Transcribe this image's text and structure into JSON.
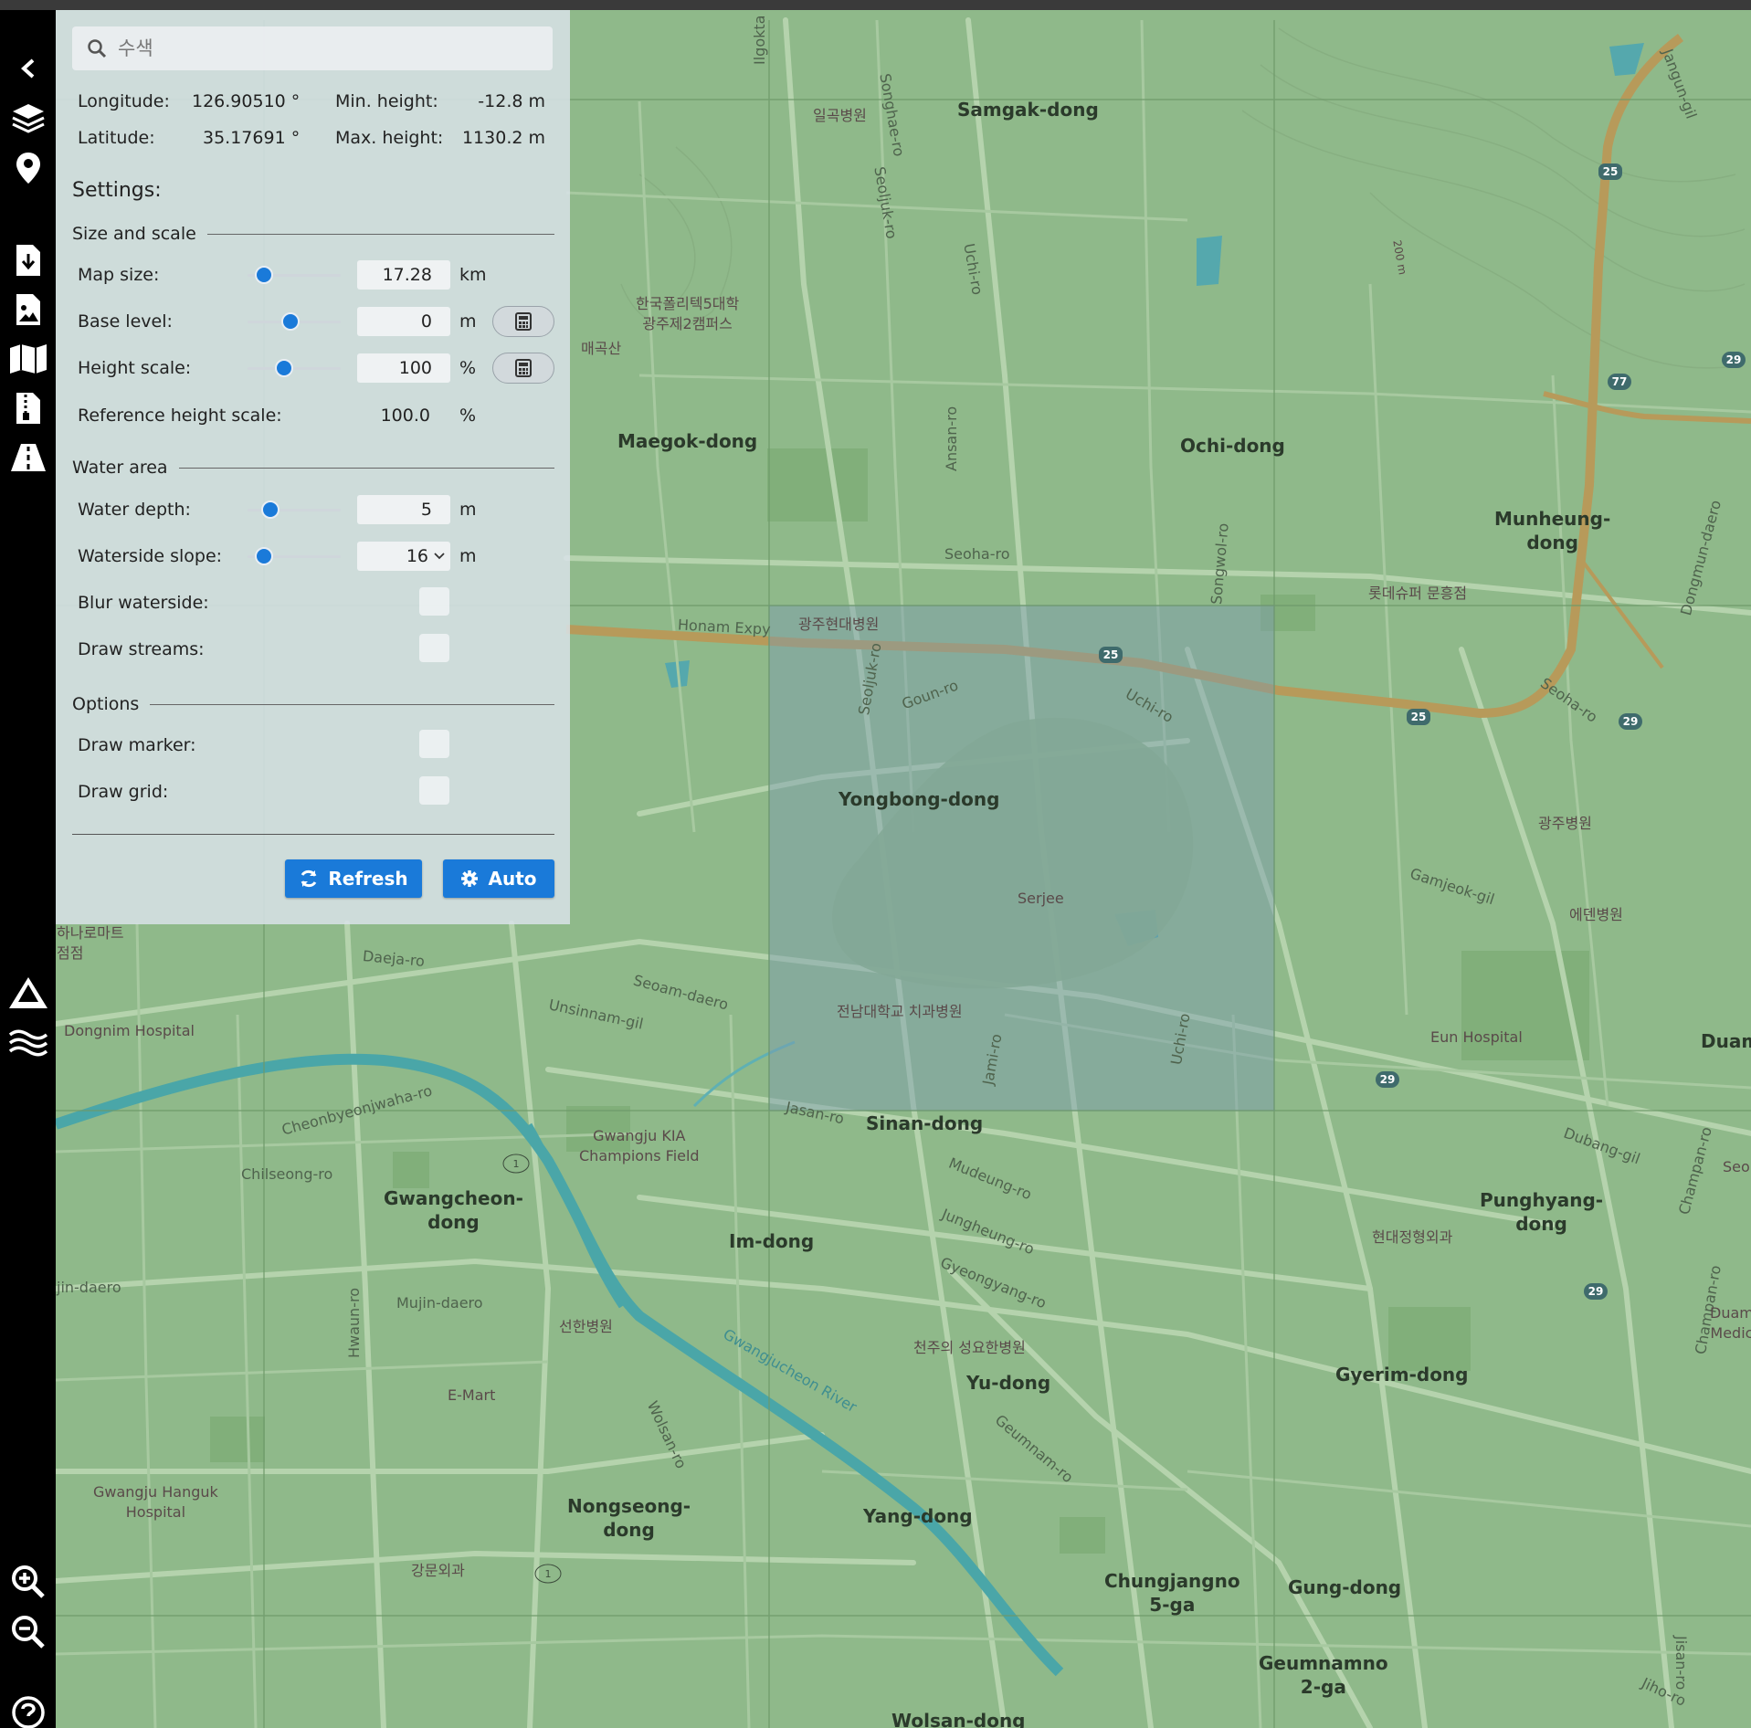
{
  "search": {
    "placeholder": "수색"
  },
  "info": {
    "longitude_label": "Longitude:",
    "longitude_value": "126.90510 °",
    "latitude_label": "Latitude:",
    "latitude_value": "35.17691 °",
    "min_height_label": "Min. height:",
    "min_height_value": "-12.8 m",
    "max_height_label": "Max. height:",
    "max_height_value": "1130.2 m"
  },
  "settings": {
    "heading": "Settings:",
    "size_scale": {
      "section": "Size and scale",
      "map_size": {
        "label": "Map size:",
        "value": "17.28",
        "unit": "km",
        "level": 0.1
      },
      "base_level": {
        "label": "Base level:",
        "value": "0",
        "unit": "m",
        "level": 0.45
      },
      "height_scale": {
        "label": "Height scale:",
        "value": "100",
        "unit": "%",
        "level": 0.37
      },
      "ref_height_scale": {
        "label": "Reference height scale:",
        "value": "100.0",
        "unit": "%"
      }
    },
    "water": {
      "section": "Water area",
      "water_depth": {
        "label": "Water depth:",
        "value": "5",
        "unit": "m",
        "level": 0.18
      },
      "waterside_slope": {
        "label": "Waterside slope:",
        "value": "16",
        "unit": "m",
        "level": 0.1
      },
      "blur_waterside": {
        "label": "Blur waterside:"
      },
      "draw_streams": {
        "label": "Draw streams:"
      }
    },
    "options": {
      "section": "Options",
      "draw_marker": {
        "label": "Draw marker:"
      },
      "draw_grid": {
        "label": "Draw grid:"
      }
    },
    "refresh_label": "Refresh",
    "auto_label": "Auto"
  },
  "map": {
    "districts": [
      "Samgak-dong",
      "Maegok-dong",
      "Ochi-dong",
      "Munheung-\ndong",
      "Yongbong-dong",
      "Sinan-dong",
      "Gwangcheon-\ndong",
      "Im-dong",
      "Punghyang-\ndong",
      "Gyerim-dong",
      "Yu-dong",
      "Nongseong-\ndong",
      "Yang-dong",
      "Chungjangno\n5-ga",
      "Gung-dong",
      "Geumnamno\n2-ga",
      "Wolsan-dong",
      "Duam"
    ],
    "streets": [
      "Ilgokta",
      "Songhae-ro",
      "Seoljuk-ro",
      "Uchi-ro",
      "Ansan-ro",
      "Seoha-ro",
      "Songwol-ro",
      "Honam Expy",
      "Goun-ro",
      "Seoljuk-ro",
      "Uchi-ro",
      "Seoha-ro",
      "Dongmun-daero",
      "Jangun-gil",
      "Gamjeok-gil",
      "Daeja-ro",
      "Seoam-daero",
      "Unsinnam-gil",
      "Cheonbyeonjwaha-ro",
      "Chilseong-ro",
      "Jasan-ro",
      "Jami-ro",
      "Uchi-ro",
      "Mudeung-ro",
      "Jungheung-ro",
      "Gyeongyang-ro",
      "Dubang-gil",
      "Champan-ro",
      "Mujin-daero",
      "Hwaun-ro",
      "Wolsan-ro",
      "Geumnam-ro",
      "jin-daero",
      "Jiho-ro",
      "Gwangjucheon River",
      "Champan-ro",
      "Jisan-ro"
    ],
    "places": [
      "일곡병원",
      "한국폴리텍5대학\n광주제2캠퍼스",
      "매곡산",
      "롯데슈퍼 문흥점",
      "광주현대병원",
      "광주병원",
      "에덴병원",
      "Serjee",
      "전남대학교 치과병원",
      "Eun Hospital",
      "Dongnim Hospital",
      "Gwangju KIA\nChampions Field",
      "선한병원",
      "천주의 성요한병원",
      "현대정형외과",
      "E-Mart",
      "Gwangju Hanguk\nHospital",
      "강문외과",
      "하나로마트\n점점",
      "Seo",
      "Duam\nMedic",
      "200 m"
    ],
    "route_badges": [
      "25",
      "25",
      "25",
      "29",
      "77",
      "29",
      "29",
      "29",
      "1",
      "1"
    ]
  },
  "colors": {
    "accent": "#1a7ad9",
    "selection": "#7c9cb0",
    "expressway": "#b79a5a",
    "river": "#4aa6a8"
  },
  "icons": [
    "back-icon",
    "layers-icon",
    "location-pin-icon",
    "download-icon",
    "file-icon",
    "map-icon",
    "zip-file-icon",
    "road-icon",
    "terrain-icon",
    "water-icon",
    "zoom-in-icon",
    "zoom-out-icon",
    "help-icon",
    "search-icon",
    "calculator-icon",
    "sync-icon",
    "gear-icon"
  ]
}
